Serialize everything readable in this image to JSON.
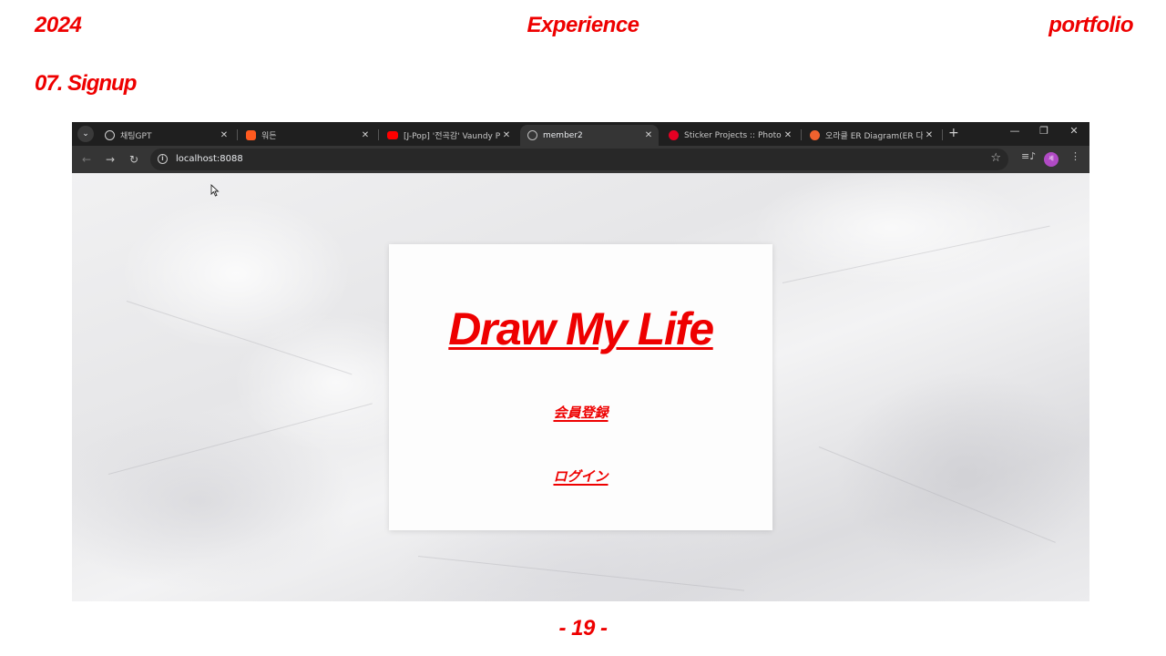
{
  "slide": {
    "year": "2024",
    "section": "Experience",
    "label_right": "portfolio",
    "chapter": "07. Signup",
    "page_number": "- 19 -"
  },
  "browser": {
    "tabs": [
      {
        "title": "채팅GPT",
        "icon": "chatgpt-icon",
        "active": false
      },
      {
        "title": "워든",
        "icon": "app-favicon",
        "active": false
      },
      {
        "title": "[J-Pop] '전곡감' Vaundy Pl",
        "icon": "youtube-icon",
        "active": false
      },
      {
        "title": "member2",
        "icon": "globe-icon",
        "active": true
      },
      {
        "title": "Sticker Projects :: Photos, ",
        "icon": "pinterest-icon",
        "active": false
      },
      {
        "title": "오라클 ER Diagram(ER 다",
        "icon": "tistory-icon",
        "active": false
      }
    ],
    "new_tab": "+",
    "address": "localhost:8088",
    "profile_initial": "세"
  },
  "page": {
    "title": "Draw My Life",
    "signup_link": "会員登録",
    "login_link": "ログイン"
  },
  "colors": {
    "accent": "#ee0000",
    "browser_frame": "#1f1f1f",
    "toolbar": "#353535"
  }
}
